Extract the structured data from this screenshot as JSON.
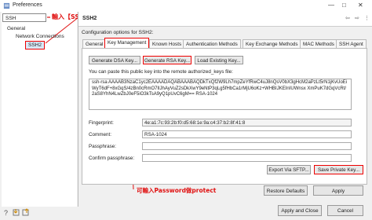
{
  "window": {
    "title": "Preferences"
  },
  "search": {
    "value": "SSH",
    "annotation": "輸入【SSH】"
  },
  "tree": {
    "general": "General",
    "network": "Network Connections",
    "ssh2": "SSH2"
  },
  "page": {
    "title": "SSH2"
  },
  "config_label": "Configuration options for SSH2:",
  "tabs": [
    "General",
    "Key Management",
    "Known Hosts",
    "Authentication Methods",
    "Key Exchange Methods",
    "MAC Methods",
    "SSH Agent"
  ],
  "key_buttons": {
    "generate_dsa": "Generate DSA Key...",
    "generate_rsa": "Generate RSA Key...",
    "load_existing": "Load Existing Key..."
  },
  "paste_label": "You can paste this public key into the remote authorized_keys file:",
  "public_key": "ssh-rsa AAAAB3NzaC1yc2EAAAADAQABAAABAQDkTxQf2W9Lh7mpZeYfRwC4uJ8nQsV0bX3gHcM2aPzLt5rN1jKvUoEiWyT6dF+8xGqS/4zBn0cRmO7lIJhAyVuZ2sDkXwY9eNtP3qLg5fHbCa1rMjU6oKz+WHBIJKEInIUWnsx XmPuK7dGqVcRt/2aS8YhN4LwZbJ0eF5iO3kTsA9yQ1pUvC6gM== RSA-1024",
  "fields": {
    "fingerprint_label": "Fingerprint:",
    "fingerprint_value": "4e:a1:7c:93:2b:f0:d5:68:1e:9a:c4:37:b2:8f:41:8",
    "comment_label": "Comment:",
    "comment_value": "RSA-1024",
    "passphrase_label": "Passphrase:",
    "passphrase_value": "",
    "confirm_label": "Confirm passphrase:",
    "confirm_value": ""
  },
  "export_button": "Export Via SFTP...",
  "save_private_button": "Save Private Key...",
  "password_annotation": "可輸入Password做protect",
  "footer": {
    "restore": "Restore Defaults",
    "apply": "Apply",
    "apply_close": "Apply and Close",
    "cancel": "Cancel"
  },
  "colors": {
    "annotation_red": "#e01010",
    "selection_blue": "#d8e8f8"
  }
}
